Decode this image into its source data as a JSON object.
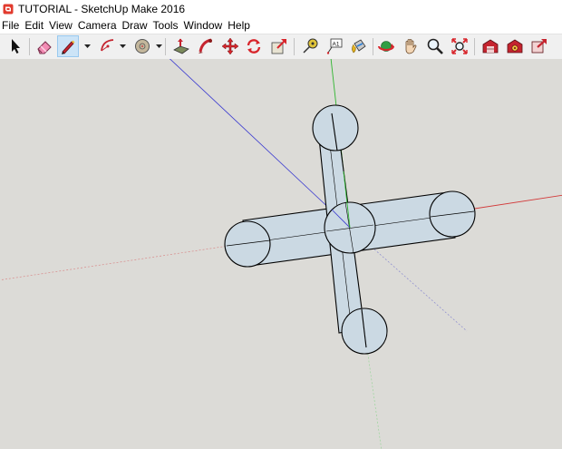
{
  "window": {
    "title": "TUTORIAL - SketchUp Make 2016",
    "icon": "sketchup-logo-icon"
  },
  "menu": [
    {
      "label": "File"
    },
    {
      "label": "Edit"
    },
    {
      "label": "View"
    },
    {
      "label": "Camera"
    },
    {
      "label": "Draw"
    },
    {
      "label": "Tools"
    },
    {
      "label": "Window"
    },
    {
      "label": "Help"
    }
  ],
  "toolbar": {
    "tools": [
      {
        "icon": "select-arrow-icon",
        "active": false
      },
      {
        "icon": "eraser-icon",
        "active": false
      },
      {
        "icon": "pencil-line-icon",
        "active": true,
        "dropdown": true
      },
      {
        "icon": "arc-icon",
        "active": false,
        "dropdown": true
      },
      {
        "icon": "circle-shape-icon",
        "active": false,
        "dropdown": true
      },
      {
        "icon": "push-pull-icon",
        "active": false
      },
      {
        "icon": "follow-me-icon",
        "active": false
      },
      {
        "icon": "move-icon",
        "active": false
      },
      {
        "icon": "rotate-icon",
        "active": false
      },
      {
        "icon": "scale-icon",
        "active": false
      },
      {
        "icon": "tape-measure-icon",
        "active": false
      },
      {
        "icon": "text-label-icon",
        "active": false
      },
      {
        "icon": "paint-bucket-icon",
        "active": false
      },
      {
        "icon": "orbit-icon",
        "active": false
      },
      {
        "icon": "pan-hand-icon",
        "active": false
      },
      {
        "icon": "zoom-icon",
        "active": false
      },
      {
        "icon": "zoom-extents-icon",
        "active": false
      },
      {
        "icon": "3d-warehouse-icon",
        "active": false
      },
      {
        "icon": "extension-warehouse-icon",
        "active": false
      },
      {
        "icon": "share-model-icon",
        "active": false
      }
    ],
    "text_tool_glyph": "A1"
  },
  "colors": {
    "canvas": "#dcdbd7",
    "face": "#cbd9e3",
    "edge": "#000000",
    "axis_red": "#d23a3a",
    "axis_green": "#2fb52f",
    "axis_blue": "#3a3ad0",
    "selection_blue": "#99c9ef"
  }
}
